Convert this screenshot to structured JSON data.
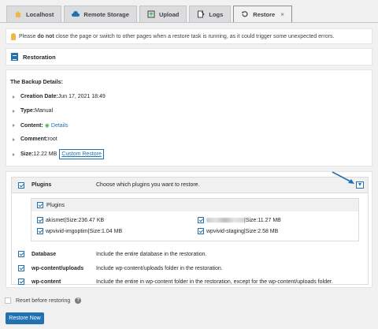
{
  "tabs": [
    {
      "label": "Localhost",
      "icon": "home-icon"
    },
    {
      "label": "Remote Storage",
      "icon": "cloud-icon"
    },
    {
      "label": "Upload",
      "icon": "upload-icon"
    },
    {
      "label": "Logs",
      "icon": "log-icon"
    },
    {
      "label": "Restore",
      "icon": "restore-icon",
      "active": true,
      "close": "×"
    }
  ],
  "notice": {
    "pre": "Please ",
    "bold": "do not",
    "post": " close the page or switch to other pages when a restore task is running, as it could trigger some unexpected errors."
  },
  "restoration_title": "Restoration",
  "details": {
    "title": "The Backup Details:",
    "creation_label": "Creation Date:",
    "creation_value": "Jun 17, 2021 18:49",
    "type_label": "Type:",
    "type_value": "Manual",
    "content_label": "Content:",
    "content_link": "Details",
    "comment_label": "Comment:",
    "comment_value": "root",
    "size_label": "Size:",
    "size_value": "12.22 MB",
    "custom_restore": "Custom Restore"
  },
  "options": {
    "plugins": {
      "name": "Plugins",
      "desc": "Choose which plugins you want to restore."
    },
    "plugins_header": "Plugins",
    "plugin_items": [
      {
        "label": "akismet|Size:236.47 KB"
      },
      {
        "label": "|Size:11.27 MB",
        "blurred": true
      },
      {
        "label": "wpvivid-imgoptim|Size:1.04 MB"
      },
      {
        "label": "wpvivid-staging|Size:2.58 MB"
      }
    ],
    "database": {
      "name": "Database",
      "desc": "Include the entire database in the restoration."
    },
    "uploads": {
      "name": "wp-content/uploads",
      "desc": "Include wp-content/uploads folder in the restoration."
    },
    "content": {
      "name": "wp-content",
      "desc": "Include the entire in wp-content folder in the restoration, except for the wp-content/uploads folder."
    }
  },
  "reset_label": "Reset before restoring",
  "restore_button": "Restore Now",
  "colors": {
    "accent": "#2271b1",
    "notice": "#f0b849",
    "eye": "#46b450"
  }
}
